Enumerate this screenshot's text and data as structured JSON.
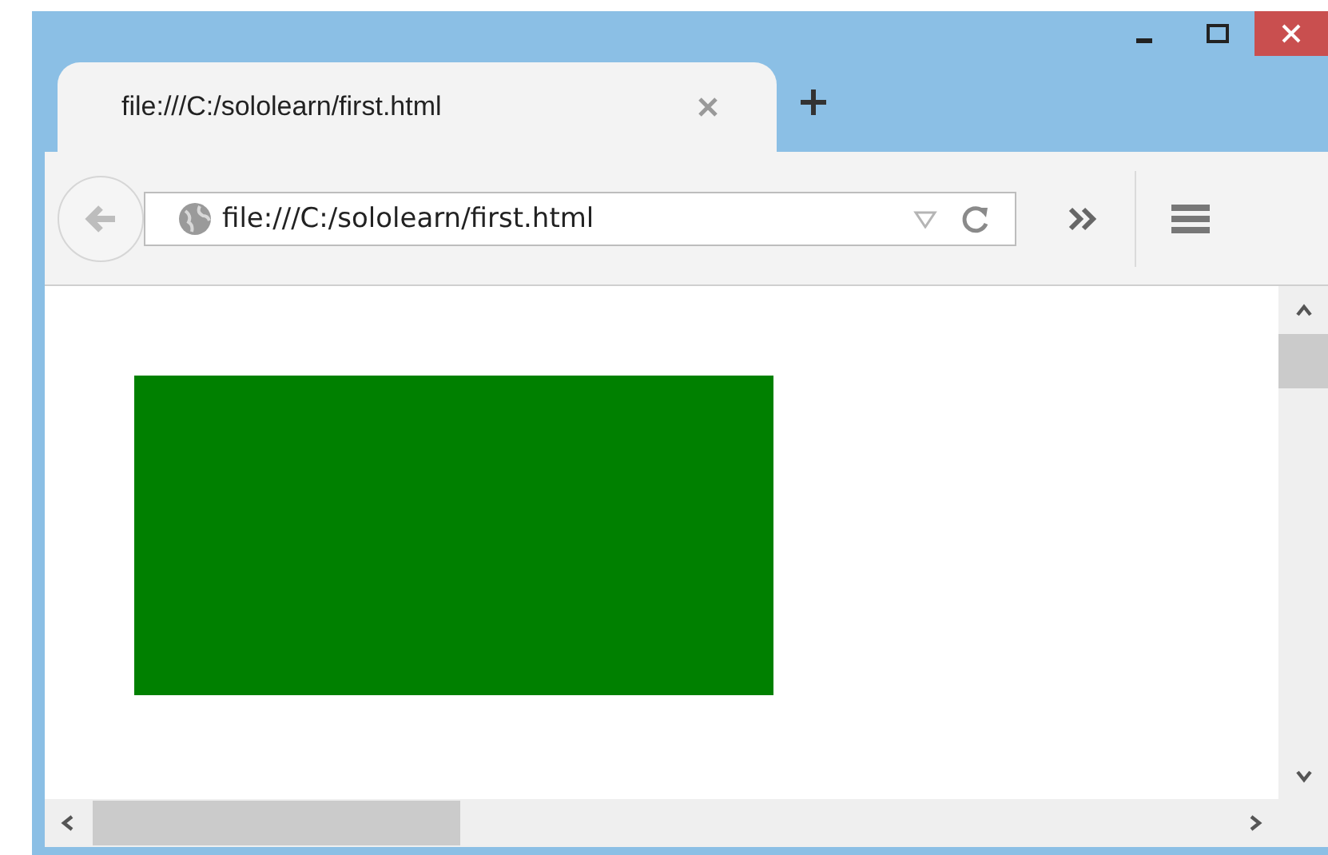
{
  "tabs": [
    {
      "title": "file:///C:/sololearn/first.html",
      "selected": true
    }
  ],
  "address_bar": {
    "value": "file:///C:/sololearn/first.html"
  }
}
